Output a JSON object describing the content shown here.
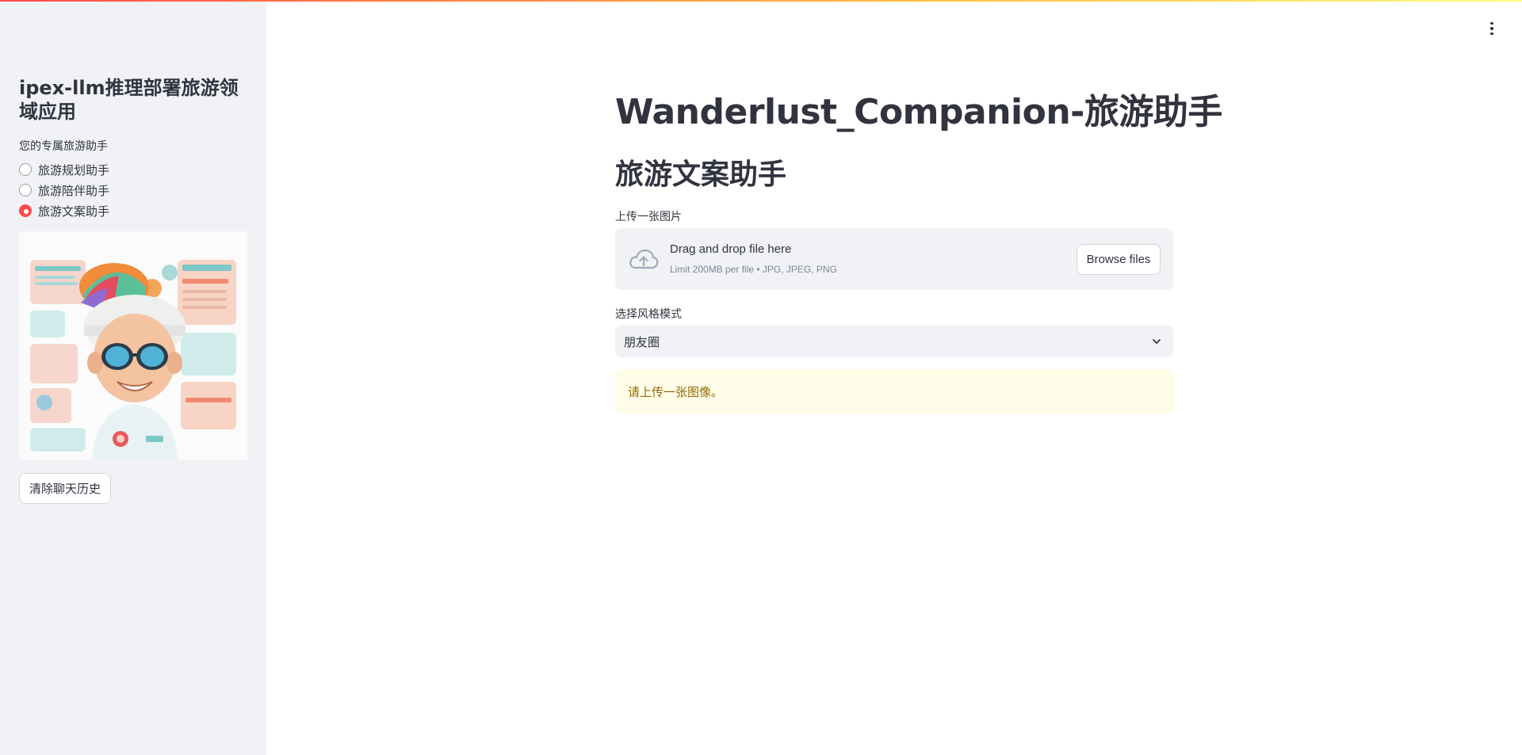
{
  "sidebar": {
    "title": "ipex-llm推理部署旅游领域应用",
    "radio_label": "您的专属旅游助手",
    "options": [
      {
        "label": "旅游规划助手",
        "selected": false
      },
      {
        "label": "旅游陪伴助手",
        "selected": false
      },
      {
        "label": "旅游文案助手",
        "selected": true
      }
    ],
    "image_alt": "cartoon traveler with sunglasses and colorful hat",
    "clear_button": "清除聊天历史"
  },
  "main": {
    "title": "Wanderlust_Companion-旅游助手",
    "section_title": "旅游文案助手",
    "upload": {
      "label": "上传一张图片",
      "drop_text": "Drag and drop file here",
      "limit_text": "Limit 200MB per file • JPG, JPEG, PNG",
      "browse_button": "Browse files"
    },
    "style_select": {
      "label": "选择风格模式",
      "value": "朋友圈"
    },
    "warning": "请上传一张图像。"
  },
  "colors": {
    "accent": "#ff4b4b",
    "sidebar_bg": "#f0f2f6",
    "warning_bg": "#fffce7",
    "warning_text": "#926c05"
  },
  "icons": [
    "cloud-upload-icon",
    "chevron-down-icon",
    "more-vertical-icon"
  ]
}
